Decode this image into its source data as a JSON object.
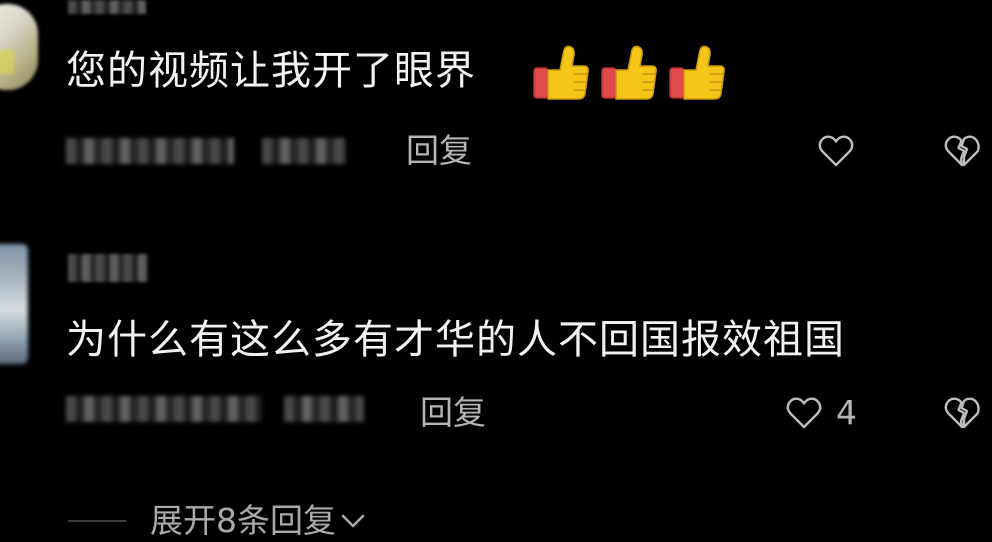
{
  "comments": [
    {
      "text": "您的视频让我开了眼界",
      "emoji": [
        "thumbs-up",
        "thumbs-up",
        "thumbs-up"
      ],
      "reply_label": "回复"
    },
    {
      "text": "为什么有这么多有才华的人不回国报效祖国",
      "reply_label": "回复",
      "like_count": "4"
    }
  ],
  "expand_replies_label": "展开8条回复",
  "colors": {
    "background": "#000000",
    "text": "#f2f2f2",
    "meta": "#b5b5b5",
    "thumb": "#f5c518",
    "cuff": "#e04a4a"
  },
  "icons": [
    "heart-icon",
    "broken-heart-icon",
    "chevron-down-icon",
    "thumbs-up-icon"
  ]
}
